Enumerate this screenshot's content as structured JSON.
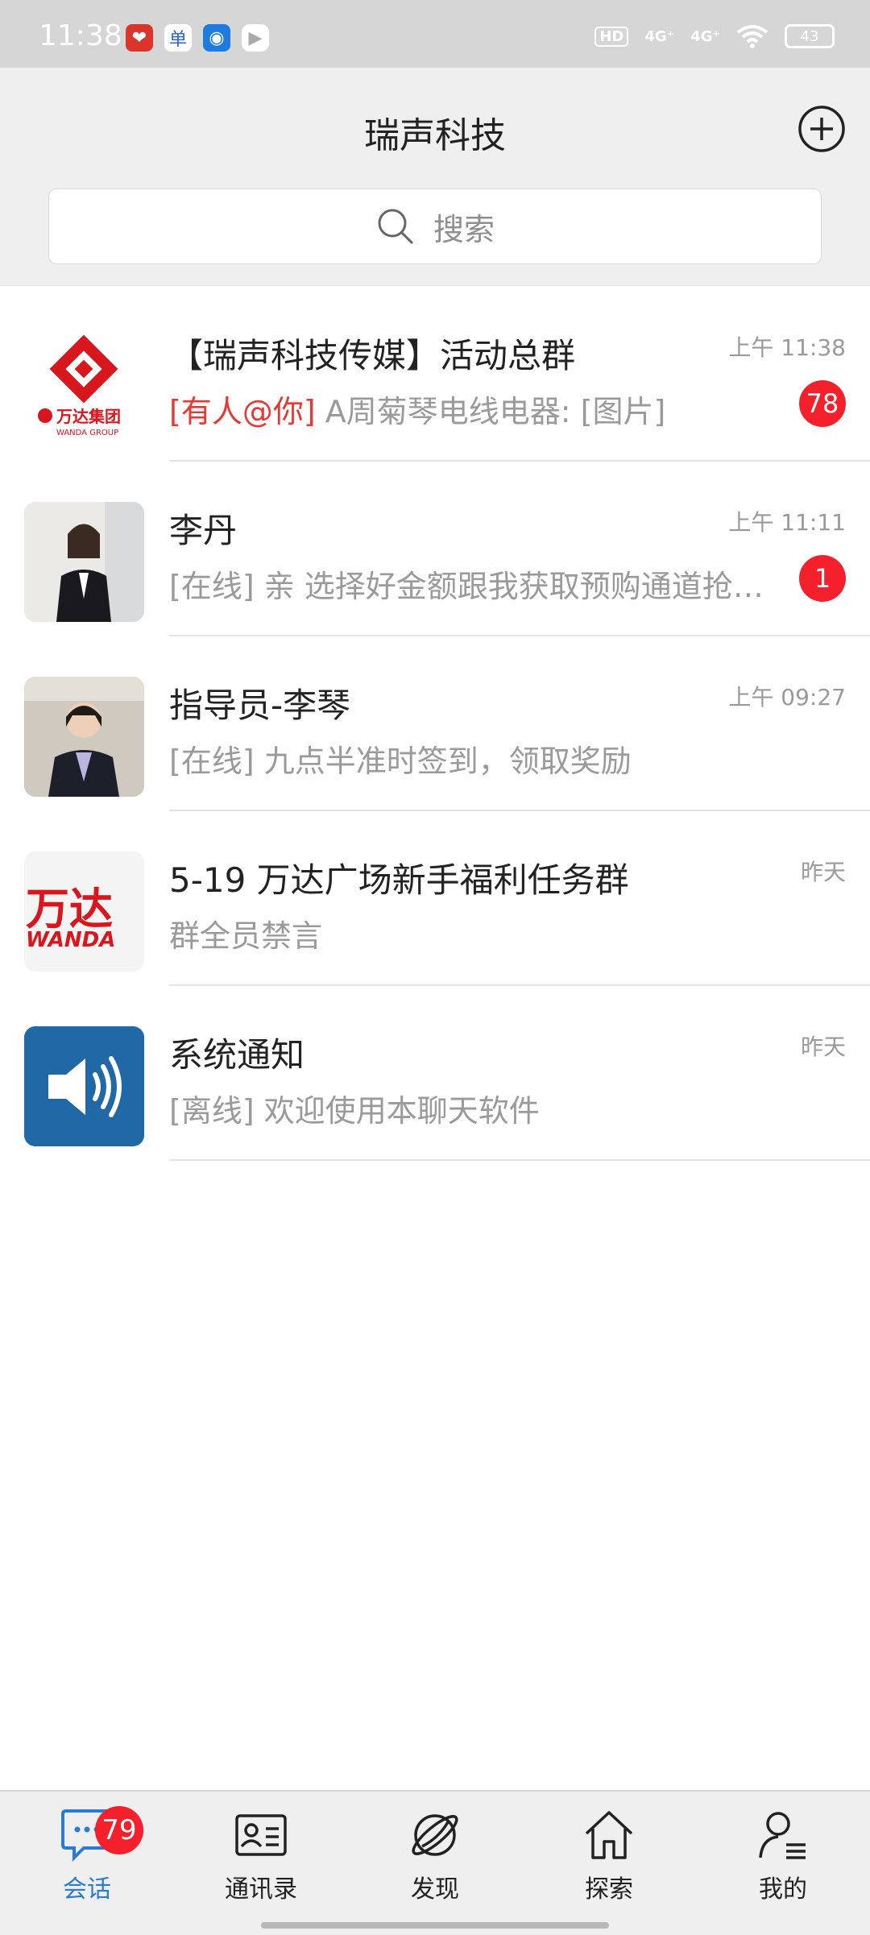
{
  "status_bar": {
    "time": "11:38",
    "hd": "HD",
    "net1": "4G⁺",
    "net2": "4G⁺",
    "battery": "43"
  },
  "header": {
    "title": "瑞声科技",
    "search_placeholder": "搜索"
  },
  "chats": [
    {
      "title": "【瑞声科技传媒】活动总群",
      "time": "上午 11:38",
      "mention": "[有人@你]",
      "preview": " A周菊琴电线电器: [图片]",
      "badge": "78"
    },
    {
      "title": "李丹",
      "time": "上午 11:11",
      "preview": "[在线] 亲 选择好金额跟我获取预购通道抢购哦",
      "badge": "1"
    },
    {
      "title": "指导员-李琴",
      "time": "上午 09:27",
      "preview": "[在线] 九点半准时签到，领取奖励"
    },
    {
      "title": "5-19  万达广场新手福利任务群",
      "time": "昨天",
      "preview": "群全员禁言"
    },
    {
      "title": "系统通知",
      "time": "昨天",
      "preview": "[离线] 欢迎使用本聊天软件"
    }
  ],
  "wanda_logo": {
    "cn": "万达集团",
    "en": "WANDA GROUP",
    "cn2": "万达",
    "en2": "WANDA"
  },
  "tabs": [
    {
      "label": "会话",
      "badge": "79"
    },
    {
      "label": "通讯录"
    },
    {
      "label": "发现"
    },
    {
      "label": "探索"
    },
    {
      "label": "我的"
    }
  ],
  "colors": {
    "accent": "#2b7bd6",
    "badge": "#f4202c",
    "mention": "#e53935"
  }
}
